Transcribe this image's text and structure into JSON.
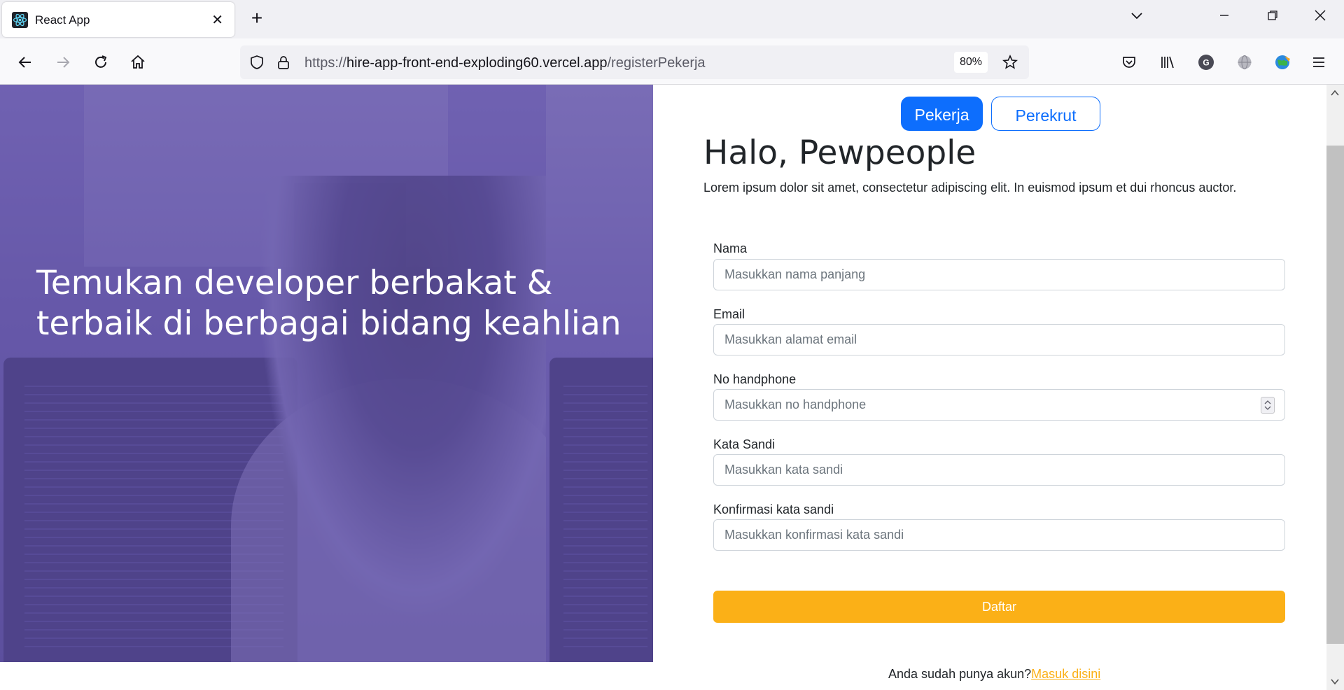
{
  "browser": {
    "tab_title": "React App",
    "close_glyph": "✕",
    "new_tab_glyph": "+",
    "url_scheme": "https://",
    "url_host": "hire-app-front-end-exploding60.vercel.app",
    "url_path": "/registerPekerja",
    "zoom": "80%",
    "profile_initial": "G"
  },
  "hero": {
    "title": "Temukan developer berbakat & terbaik di berbagai bidang keahlian"
  },
  "roles": {
    "active": "Pekerja",
    "inactive": "Perekrut"
  },
  "header": {
    "greeting": "Halo, Pewpeople",
    "lead": "Lorem ipsum dolor sit amet, consectetur adipiscing elit. In euismod ipsum et dui rhoncus auctor."
  },
  "form": {
    "fields": [
      {
        "label": "Nama",
        "placeholder": "Masukkan nama panjang"
      },
      {
        "label": "Email",
        "placeholder": "Masukkan alamat email"
      },
      {
        "label": "No handphone",
        "placeholder": "Masukkan no handphone"
      },
      {
        "label": "Kata Sandi",
        "placeholder": "Masukkan kata sandi"
      },
      {
        "label": "Konfirmasi kata sandi",
        "placeholder": "Masukkan konfirmasi kata sandi"
      }
    ],
    "submit": "Daftar"
  },
  "footer": {
    "prompt": "Anda sudah punya akun?",
    "link": "Masuk disini"
  },
  "colors": {
    "primary": "#0d6efd",
    "accent": "#fbb017",
    "hero_overlay": "#5e50a1"
  }
}
